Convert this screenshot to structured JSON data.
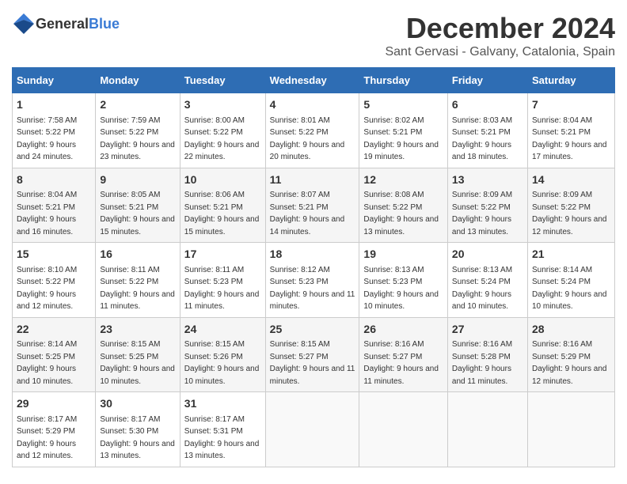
{
  "header": {
    "logo_general": "General",
    "logo_blue": "Blue",
    "main_title": "December 2024",
    "subtitle": "Sant Gervasi - Galvany, Catalonia, Spain"
  },
  "calendar": {
    "days_of_week": [
      "Sunday",
      "Monday",
      "Tuesday",
      "Wednesday",
      "Thursday",
      "Friday",
      "Saturday"
    ],
    "weeks": [
      [
        {
          "day": "1",
          "sunrise": "7:58 AM",
          "sunset": "5:22 PM",
          "daylight": "9 hours and 24 minutes."
        },
        {
          "day": "2",
          "sunrise": "7:59 AM",
          "sunset": "5:22 PM",
          "daylight": "9 hours and 23 minutes."
        },
        {
          "day": "3",
          "sunrise": "8:00 AM",
          "sunset": "5:22 PM",
          "daylight": "9 hours and 22 minutes."
        },
        {
          "day": "4",
          "sunrise": "8:01 AM",
          "sunset": "5:22 PM",
          "daylight": "9 hours and 20 minutes."
        },
        {
          "day": "5",
          "sunrise": "8:02 AM",
          "sunset": "5:21 PM",
          "daylight": "9 hours and 19 minutes."
        },
        {
          "day": "6",
          "sunrise": "8:03 AM",
          "sunset": "5:21 PM",
          "daylight": "9 hours and 18 minutes."
        },
        {
          "day": "7",
          "sunrise": "8:04 AM",
          "sunset": "5:21 PM",
          "daylight": "9 hours and 17 minutes."
        }
      ],
      [
        {
          "day": "8",
          "sunrise": "8:04 AM",
          "sunset": "5:21 PM",
          "daylight": "9 hours and 16 minutes."
        },
        {
          "day": "9",
          "sunrise": "8:05 AM",
          "sunset": "5:21 PM",
          "daylight": "9 hours and 15 minutes."
        },
        {
          "day": "10",
          "sunrise": "8:06 AM",
          "sunset": "5:21 PM",
          "daylight": "9 hours and 15 minutes."
        },
        {
          "day": "11",
          "sunrise": "8:07 AM",
          "sunset": "5:21 PM",
          "daylight": "9 hours and 14 minutes."
        },
        {
          "day": "12",
          "sunrise": "8:08 AM",
          "sunset": "5:22 PM",
          "daylight": "9 hours and 13 minutes."
        },
        {
          "day": "13",
          "sunrise": "8:09 AM",
          "sunset": "5:22 PM",
          "daylight": "9 hours and 13 minutes."
        },
        {
          "day": "14",
          "sunrise": "8:09 AM",
          "sunset": "5:22 PM",
          "daylight": "9 hours and 12 minutes."
        }
      ],
      [
        {
          "day": "15",
          "sunrise": "8:10 AM",
          "sunset": "5:22 PM",
          "daylight": "9 hours and 12 minutes."
        },
        {
          "day": "16",
          "sunrise": "8:11 AM",
          "sunset": "5:22 PM",
          "daylight": "9 hours and 11 minutes."
        },
        {
          "day": "17",
          "sunrise": "8:11 AM",
          "sunset": "5:23 PM",
          "daylight": "9 hours and 11 minutes."
        },
        {
          "day": "18",
          "sunrise": "8:12 AM",
          "sunset": "5:23 PM",
          "daylight": "9 hours and 11 minutes."
        },
        {
          "day": "19",
          "sunrise": "8:13 AM",
          "sunset": "5:23 PM",
          "daylight": "9 hours and 10 minutes."
        },
        {
          "day": "20",
          "sunrise": "8:13 AM",
          "sunset": "5:24 PM",
          "daylight": "9 hours and 10 minutes."
        },
        {
          "day": "21",
          "sunrise": "8:14 AM",
          "sunset": "5:24 PM",
          "daylight": "9 hours and 10 minutes."
        }
      ],
      [
        {
          "day": "22",
          "sunrise": "8:14 AM",
          "sunset": "5:25 PM",
          "daylight": "9 hours and 10 minutes."
        },
        {
          "day": "23",
          "sunrise": "8:15 AM",
          "sunset": "5:25 PM",
          "daylight": "9 hours and 10 minutes."
        },
        {
          "day": "24",
          "sunrise": "8:15 AM",
          "sunset": "5:26 PM",
          "daylight": "9 hours and 10 minutes."
        },
        {
          "day": "25",
          "sunrise": "8:15 AM",
          "sunset": "5:27 PM",
          "daylight": "9 hours and 11 minutes."
        },
        {
          "day": "26",
          "sunrise": "8:16 AM",
          "sunset": "5:27 PM",
          "daylight": "9 hours and 11 minutes."
        },
        {
          "day": "27",
          "sunrise": "8:16 AM",
          "sunset": "5:28 PM",
          "daylight": "9 hours and 11 minutes."
        },
        {
          "day": "28",
          "sunrise": "8:16 AM",
          "sunset": "5:29 PM",
          "daylight": "9 hours and 12 minutes."
        }
      ],
      [
        {
          "day": "29",
          "sunrise": "8:17 AM",
          "sunset": "5:29 PM",
          "daylight": "9 hours and 12 minutes."
        },
        {
          "day": "30",
          "sunrise": "8:17 AM",
          "sunset": "5:30 PM",
          "daylight": "9 hours and 13 minutes."
        },
        {
          "day": "31",
          "sunrise": "8:17 AM",
          "sunset": "5:31 PM",
          "daylight": "9 hours and 13 minutes."
        },
        null,
        null,
        null,
        null
      ]
    ]
  }
}
